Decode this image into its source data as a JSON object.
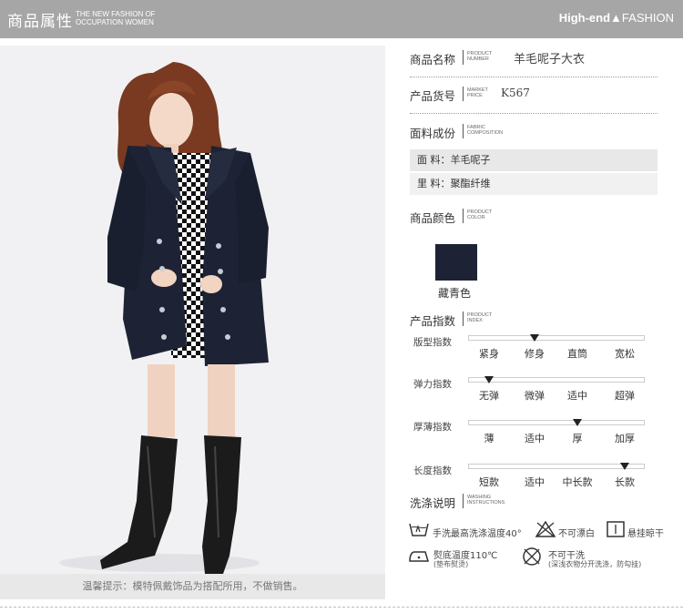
{
  "header": {
    "title": "商品属性",
    "subtitle_line1": "THE NEW FASHION OF",
    "subtitle_line2": "OCCUPATION WOMEN",
    "brand_a": "High-end",
    "brand_b": "FASHION"
  },
  "photo_note": "温馨提示：模特佩戴饰品为搭配所用，不做销售。",
  "product": {
    "name_label": "商品名称",
    "name_sub1": "PRODUCT",
    "name_sub2": "NUMBER",
    "name_value": "羊毛呢子大衣",
    "code_label": "产品货号",
    "code_sub1": "MARKET",
    "code_sub2": "PRICE",
    "code_value": "K567",
    "fabric_label": "面料成份",
    "fabric_sub1": "FABRIC",
    "fabric_sub2": "COMPOSITION",
    "fabric_outer": "面    料：羊毛呢子",
    "fabric_inner": "里    料：聚酯纤维",
    "color_label": "商品颜色",
    "color_sub1": "PRODUCT",
    "color_sub2": "COLOR",
    "color_name": "藏青色",
    "color_hex": "#1e2235"
  },
  "index": {
    "label": "产品指数",
    "sub1": "PRODUCT",
    "sub2": "INDEX",
    "rows": [
      {
        "label": "版型指数",
        "options": [
          "紧身",
          "修身",
          "直筒",
          "宽松"
        ],
        "selected": 1
      },
      {
        "label": "弹力指数",
        "options": [
          "无弹",
          "微弹",
          "适中",
          "超弹"
        ],
        "selected": 0
      },
      {
        "label": "厚薄指数",
        "options": [
          "薄",
          "适中",
          "厚",
          "加厚"
        ],
        "selected": 2
      },
      {
        "label": "长度指数",
        "options": [
          "短款",
          "适中",
          "中长款",
          "长款"
        ],
        "selected": 3
      }
    ]
  },
  "washing": {
    "label": "洗涤说明",
    "sub1": "WASHING",
    "sub2": "INSTRUCTIONS",
    "items": {
      "wash_temp": "手洗最高洗涤温度40°",
      "no_bleach": "不可漂白",
      "hang_dry": "悬挂晾干",
      "iron": "熨底温度110℃",
      "iron_note": "(垫布熨烫)",
      "no_tumble": "不可干洗",
      "no_tumble_note": "(深浅衣物分开洗涤，防勾挂)"
    }
  }
}
